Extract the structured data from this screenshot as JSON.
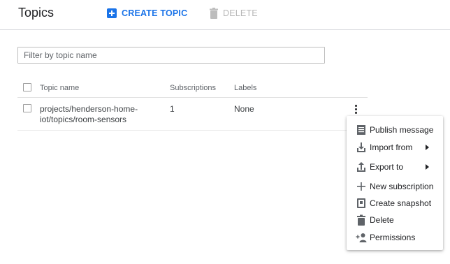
{
  "header": {
    "title": "Topics",
    "create_label": "CREATE TOPIC",
    "delete_label": "DELETE"
  },
  "filter": {
    "placeholder": "Filter by topic name",
    "value": ""
  },
  "table": {
    "columns": [
      "Topic name",
      "Subscriptions",
      "Labels"
    ],
    "rows": [
      {
        "name_line1": "projects/henderson-home-",
        "name_line2": "iot/topics/room-sensors",
        "subscriptions": "1",
        "labels": "None"
      }
    ]
  },
  "menu": {
    "items": [
      {
        "label": "Publish message",
        "icon": "publish-message-icon",
        "submenu": false
      },
      {
        "label": "Import from",
        "icon": "import-icon",
        "submenu": true
      },
      {
        "label": "Export to",
        "icon": "export-icon",
        "submenu": true
      },
      {
        "label": "New subscription",
        "icon": "plus-icon",
        "submenu": false
      },
      {
        "label": "Create snapshot",
        "icon": "snapshot-icon",
        "submenu": false
      },
      {
        "label": "Delete",
        "icon": "trash-icon",
        "submenu": false
      },
      {
        "label": "Permissions",
        "icon": "add-person-icon",
        "submenu": false
      }
    ]
  },
  "colors": {
    "accent": "#1a73e8",
    "disabled": "#b7b7b7",
    "text": "#202124",
    "muted": "#5f6368",
    "divider": "#dadce0"
  }
}
